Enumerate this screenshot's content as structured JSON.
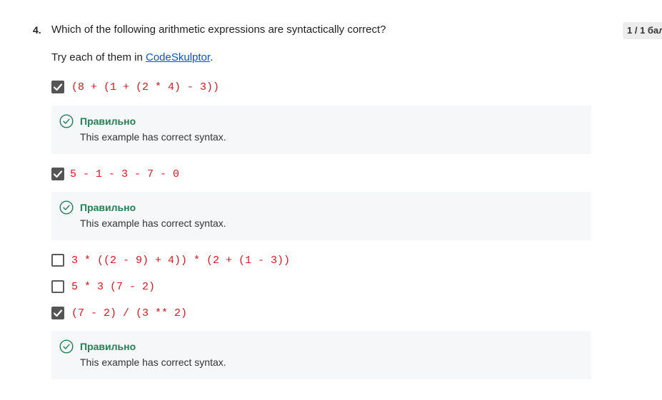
{
  "question": {
    "number": "4.",
    "text": "Which of the following arithmetic expressions are syntactically correct?",
    "score": "1 / 1 бал",
    "instruction_prefix": "Try each of them in ",
    "instruction_link": "CodeSkulptor",
    "instruction_suffix": "."
  },
  "options": [
    {
      "code": "(8 + (1 + (2 * 4) - 3))",
      "checked": true
    },
    {
      "code": "5 - 1 - 3 - 7 - 0",
      "checked": true
    },
    {
      "code": "3 * ((2 - 9) + 4)) * (2 + (1 - 3))",
      "checked": false
    },
    {
      "code": "5 * 3 (7 - 2)",
      "checked": false
    },
    {
      "code": "(7 - 2) / (3 ** 2)",
      "checked": true
    }
  ],
  "feedback": [
    {
      "title": "Правильно",
      "text": "This example has correct syntax."
    },
    {
      "title": "Правильно",
      "text": "This example has correct syntax."
    },
    {
      "title": "Правильно",
      "text": "This example has correct syntax."
    }
  ],
  "colors": {
    "code": "#e8151b",
    "correct": "#1f8354",
    "link": "#0056d2",
    "checkbox_checked": "#555555",
    "feedback_bg": "#f5f7f8"
  },
  "icons": {
    "checkmark": "checkmark-icon",
    "correct": "check-circle-icon"
  }
}
